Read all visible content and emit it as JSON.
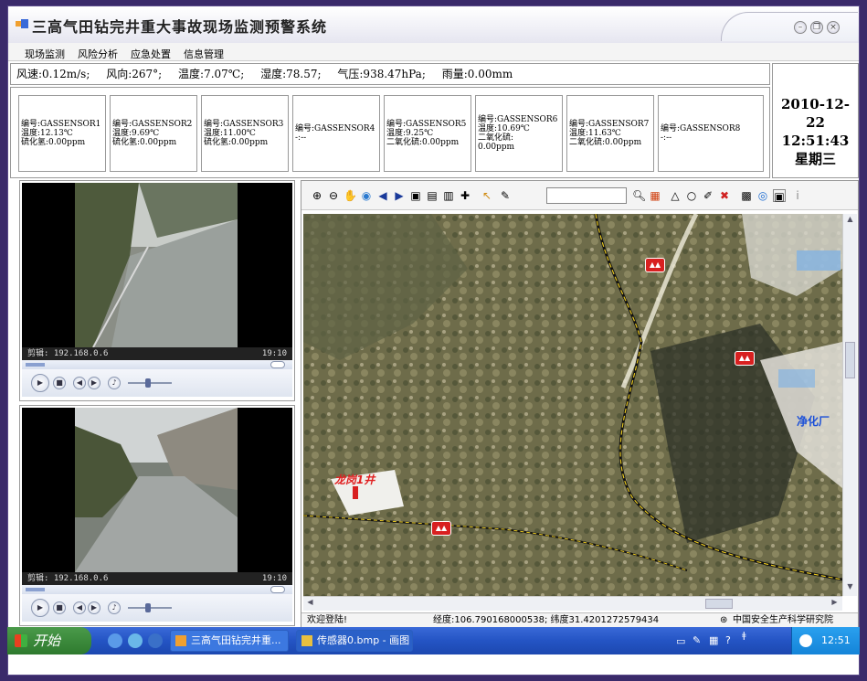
{
  "window": {
    "title": "三高气田钻完井重大事故现场监测预警系统"
  },
  "menu": {
    "items": [
      "现场监测",
      "风险分析",
      "应急处置",
      "信息管理"
    ]
  },
  "weather": {
    "wind_speed": "风速:0.12m/s;",
    "wind_dir": "风向:267°;",
    "temperature": "温度:7.07℃;",
    "humidity": "湿度:78.57;",
    "pressure": "气压:938.47hPa;",
    "rain": "雨量:0.00mm"
  },
  "sensors": [
    {
      "l1": "编号:GASSENSOR1",
      "l2": "温度:12.13℃",
      "l3": "硫化氢:0.00ppm",
      "l4": ""
    },
    {
      "l1": "编号:GASSENSOR2",
      "l2": "温度:9.69℃",
      "l3": "硫化氢:0.00ppm",
      "l4": ""
    },
    {
      "l1": "编号:GASSENSOR3",
      "l2": "温度:11.00℃",
      "l3": "硫化氢:0.00ppm",
      "l4": ""
    },
    {
      "l1": "编号:GASSENSOR4",
      "l2": "-:--",
      "l3": "",
      "l4": ""
    },
    {
      "l1": "编号:GASSENSOR5",
      "l2": "温度:9.25℃",
      "l3": "二氧化硫:0.00ppm",
      "l4": ""
    },
    {
      "l1": "编号:GASSENSOR6",
      "l2": "温度:10.69℃",
      "l3": "二氧化硫:",
      "l4": "0.00ppm"
    },
    {
      "l1": "编号:GASSENSOR7",
      "l2": "温度:11.63℃",
      "l3": "二氧化硫:0.00ppm",
      "l4": ""
    },
    {
      "l1": "编号:GASSENSOR8",
      "l2": "-:--",
      "l3": "",
      "l4": ""
    }
  ],
  "clock": {
    "date": "2010-12-22",
    "time": "12:51:43",
    "weekday": "星期三"
  },
  "videos": [
    {
      "caption": "剪辑: 192.168.0.6",
      "time": "19:10",
      "progress": 0.08,
      "volume": 0.45
    },
    {
      "caption": "剪辑: 192.168.0.6",
      "time": "19:10",
      "progress": 0.08,
      "volume": 0.45
    }
  ],
  "map": {
    "search_value": "",
    "labels": {
      "well": "龙岗1井",
      "plant": "净化厂"
    },
    "status": {
      "welcome": "欢迎登陆!",
      "coords": "经度:106.790168000538;  纬度31.4201272579434",
      "org": "中国安全生产科学研究院"
    }
  },
  "taskbar": {
    "start": "开始",
    "tasks": [
      "三高气田钻完井重...",
      "传感器0.bmp - 画图"
    ],
    "clock": "12:51"
  },
  "colors": {
    "accent": "#2454c4",
    "pin": "#d82020",
    "plant_label": "#1a4fd8"
  }
}
